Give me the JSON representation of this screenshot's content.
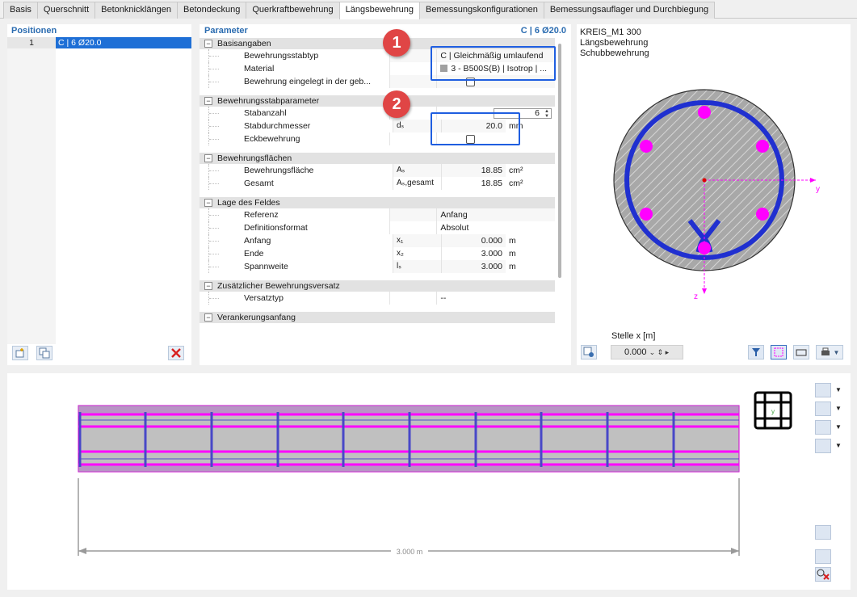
{
  "tabs": [
    "Basis",
    "Querschnitt",
    "Betonknicklängen",
    "Betondeckung",
    "Querkraftbewehrung",
    "Längsbewehrung",
    "Bemessungskonfigurationen",
    "Bemessungsauflager und Durchbiegung"
  ],
  "active_tab": "Längsbewehrung",
  "positions": {
    "title": "Positionen",
    "rows": [
      {
        "num": "1",
        "value": "C | 6 Ø20.0"
      }
    ]
  },
  "params": {
    "title": "Parameter",
    "right_label": "C | 6 Ø20.0",
    "groups": [
      {
        "label": "Basisangaben",
        "rows": [
          {
            "name": "Bewehrungsstabtyp",
            "symbol": "",
            "value": "C | Gleichmäßig umlaufend",
            "unit": ""
          },
          {
            "name": "Material",
            "symbol": "",
            "value": "3 - B500S(B) | Isotrop | ...",
            "unit": ""
          },
          {
            "name": "Bewehrung eingelegt in der geb...",
            "symbol": "",
            "value": "",
            "unit": ""
          }
        ]
      },
      {
        "label": "Bewehrungsstabparameter",
        "rows": [
          {
            "name": "Stabanzahl",
            "symbol": "nₛ",
            "value": "6",
            "unit": ""
          },
          {
            "name": "Stabdurchmesser",
            "symbol": "dₛ",
            "value": "20.0",
            "unit": "mm"
          },
          {
            "name": "Eckbewehrung",
            "symbol": "",
            "value": "",
            "unit": ""
          }
        ]
      },
      {
        "label": "Bewehrungsflächen",
        "rows": [
          {
            "name": "Bewehrungsfläche",
            "symbol": "Aₛ",
            "value": "18.85",
            "unit": "cm²"
          },
          {
            "name": "Gesamt",
            "symbol": "Aₛ,gesamt",
            "value": "18.85",
            "unit": "cm²"
          }
        ]
      },
      {
        "label": "Lage des Feldes",
        "rows": [
          {
            "name": "Referenz",
            "symbol": "",
            "value": "Anfang",
            "unit": ""
          },
          {
            "name": "Definitionsformat",
            "symbol": "",
            "value": "Absolut",
            "unit": ""
          },
          {
            "name": "Anfang",
            "symbol": "x₁",
            "value": "0.000",
            "unit": "m"
          },
          {
            "name": "Ende",
            "symbol": "x₂",
            "value": "3.000",
            "unit": "m"
          },
          {
            "name": "Spannweite",
            "symbol": "lₛ",
            "value": "3.000",
            "unit": "m"
          }
        ]
      },
      {
        "label": "Zusätzlicher Bewehrungsversatz",
        "rows": [
          {
            "name": "Versatztyp",
            "symbol": "",
            "value": "--",
            "unit": ""
          }
        ]
      },
      {
        "label": "Verankerungsanfang",
        "rows": []
      }
    ]
  },
  "badges": [
    "1",
    "2"
  ],
  "preview": {
    "line1": "KREIS_M1 300",
    "line2": "Längsbewehrung",
    "line3": "Schubbewehrung",
    "axis_y": "y",
    "axis_z": "z",
    "stelle_label": "Stelle x [m]",
    "stelle_value": "0.000"
  },
  "bottom": {
    "dimension_label": "3.000 m"
  },
  "colors": {
    "accent": "#1e6fd6",
    "highlight": "#1f5ee0",
    "badge": "#e04545",
    "rebar": "#ff00ff",
    "stirrup": "#2030d0"
  }
}
